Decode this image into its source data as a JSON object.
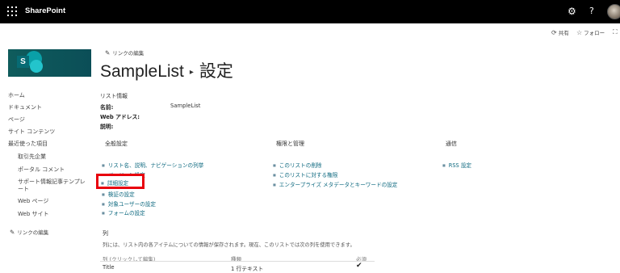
{
  "topbar": {
    "app_name": "SharePoint",
    "icons": [
      "waffle-icon",
      "gear-icon",
      "help-icon",
      "avatar"
    ],
    "help_glyph": "?"
  },
  "actions": {
    "share": "共有",
    "follow": "フォロー"
  },
  "header": {
    "edit_link": "リンクの編集",
    "list_name": "SampleList",
    "settings": "設定"
  },
  "sidebar": {
    "items": [
      {
        "label": "ホーム"
      },
      {
        "label": "ドキュメント"
      },
      {
        "label": "ページ"
      },
      {
        "label": "サイト コンテンツ"
      },
      {
        "label": "最近使った項目"
      },
      {
        "label": "取引先企業"
      },
      {
        "label": "ポータル コメント"
      },
      {
        "label": "サポート情報記事テンプレ"
      },
      {
        "label": "ート"
      },
      {
        "label": "Web ページ"
      },
      {
        "label": "Web サイト"
      }
    ],
    "edit_link": "リンクの編集"
  },
  "list_info": {
    "heading": "リスト情報",
    "name_label": "名前:",
    "name_value": "SampleList",
    "web_label": "Web アドレス:",
    "desc_label": "説明:"
  },
  "general": {
    "heading": "全般設定",
    "links": [
      "リスト名、説明、ナビゲーションの列挙",
      "バージョン設定",
      "詳細設定",
      "検証の設定",
      "対象ユーザーの設定",
      "フォームの設定"
    ]
  },
  "permissions": {
    "heading": "権限と管理",
    "links": [
      "このリストの削除",
      "このリストに対する権限",
      "エンタープライズ メタデータとキーワードの設定"
    ]
  },
  "communications": {
    "heading": "通信",
    "links": [
      "RSS 設定"
    ]
  },
  "columns": {
    "heading": "列",
    "description": "列には、リスト内の各アイテムについての情報が保存されます。現在、このリストでは次の列を使用できます。",
    "headers": [
      "列 (クリックして編集)",
      "種類",
      "必須"
    ],
    "rows": [
      {
        "name": "Title",
        "type": "1 行テキスト",
        "required": "✔"
      }
    ]
  },
  "colors": {
    "link": "#0f6a80",
    "highlight_box": "#e8000d",
    "topbar": "#000000",
    "logo": "#0f5c5c"
  }
}
